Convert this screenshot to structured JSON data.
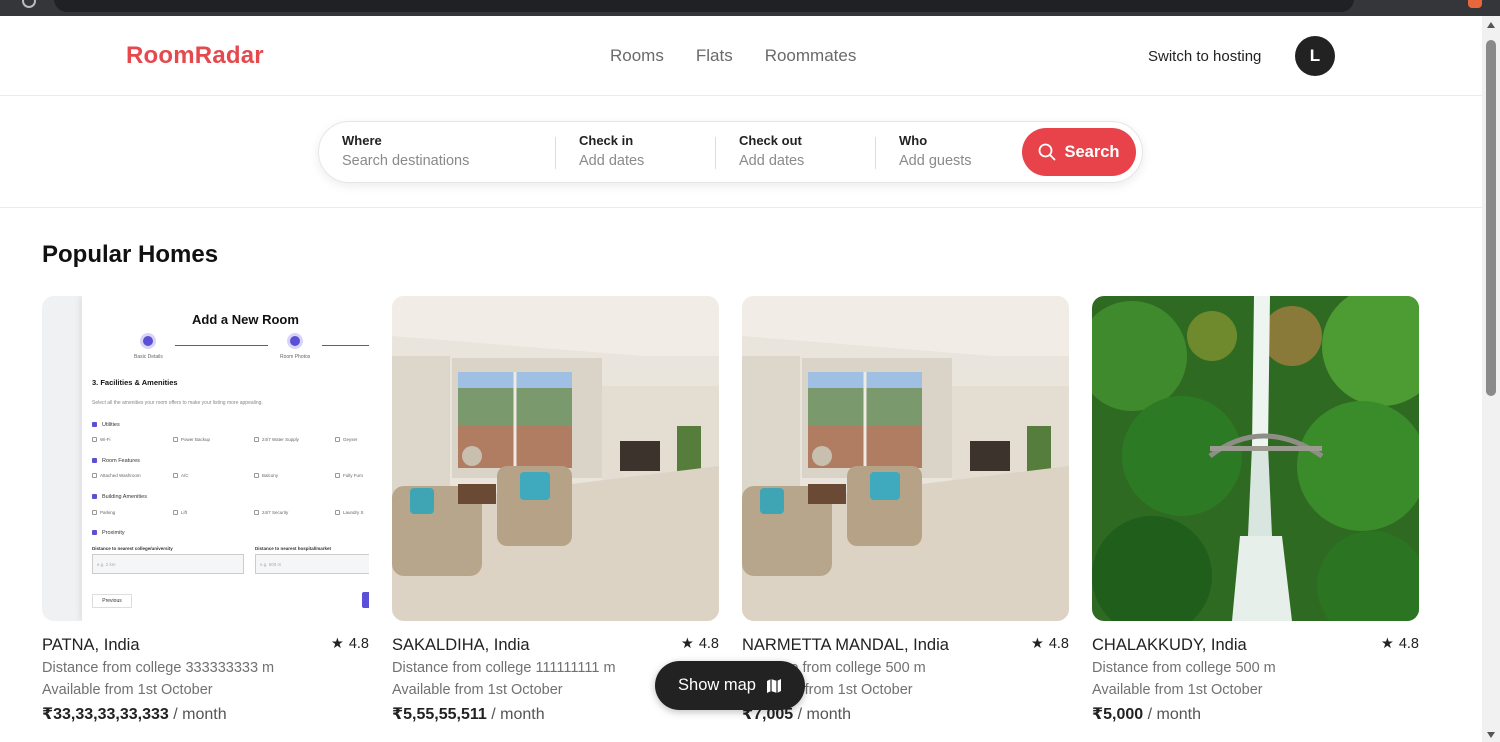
{
  "header": {
    "logo": "RoomRadar",
    "nav": [
      "Rooms",
      "Flats",
      "Roommates"
    ],
    "host_link": "Switch to hosting",
    "avatar_initial": "L"
  },
  "search": {
    "where_label": "Where",
    "where_placeholder": "Search destinations",
    "checkin_label": "Check in",
    "checkin_placeholder": "Add dates",
    "checkout_label": "Check out",
    "checkout_placeholder": "Add dates",
    "who_label": "Who",
    "who_placeholder": "Add guests",
    "button_label": "Search",
    "button_color": "#e8434a"
  },
  "section": {
    "title": "Popular Homes"
  },
  "listings": [
    {
      "city": "PATNA, India",
      "rating": "4.8",
      "distance": "Distance from college 333333333 m",
      "available": "Available from 1st October",
      "price": "₹33,33,33,33,333",
      "per": " / month",
      "image": "add-room-form-screenshot"
    },
    {
      "city": "SAKALDIHA, India",
      "rating": "4.8",
      "distance": "Distance from college 111111111 m",
      "available": "Available from 1st October",
      "price": "₹5,55,55,511",
      "per": " / month",
      "image": "living-room"
    },
    {
      "city": "NARMETTA MANDAL, India",
      "rating": "4.8",
      "distance": "Distance from college 500 m",
      "available": "Available from 1st October",
      "price": "₹7,005",
      "per": " / month",
      "image": "living-room"
    },
    {
      "city": "CHALAKKUDY, India",
      "rating": "4.8",
      "distance": "Distance from college 500 m",
      "available": "Available from 1st October",
      "price": "₹5,000",
      "per": " / month",
      "image": "waterfall-bridge"
    }
  ],
  "form_preview": {
    "title": "Add a New Room",
    "step1": "Basic Details",
    "step2": "Room Photos",
    "heading": "3. Facilities & Amenities",
    "subtitle": "Select all the amenities your room offers to make your listing more appealing.",
    "groups": [
      "Utilities",
      "Room Features",
      "Building Amenities",
      "Proximity"
    ],
    "utilities": [
      "Wi-Fi",
      "Power Backup",
      "24/7 Water Supply",
      "Geyser"
    ],
    "room_features": [
      "Attached Washroom",
      "A/C",
      "Balcony",
      "Fully Furn"
    ],
    "building": [
      "Parking",
      "Lift",
      "24/7 Security",
      "Laundry S"
    ],
    "dist_college_label": "Distance to nearest college/university",
    "dist_hospital_label": "Distance to nearest hospital/market",
    "dist_college_ph": "e.g. 2 km",
    "dist_hospital_ph": "e.g. 500 m",
    "prev": "Previous"
  },
  "show_map": {
    "label": "Show map"
  },
  "colors": {
    "brand": "#e5484d",
    "dark": "#222222"
  }
}
